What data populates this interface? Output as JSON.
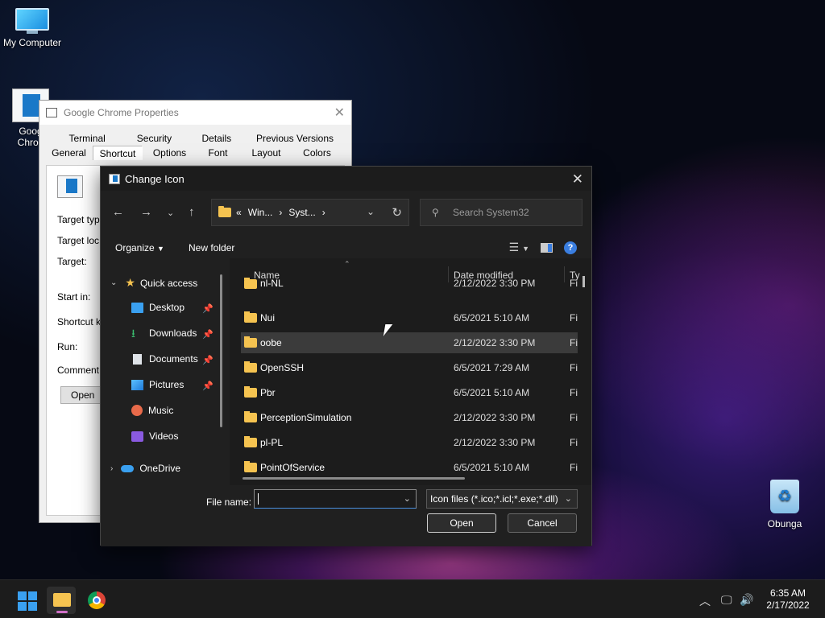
{
  "desktop": {
    "my_computer": "My Computer",
    "chrome_label_1": "Goog",
    "chrome_label_2": "Chron",
    "recycle": "Obunga"
  },
  "props": {
    "title": "Google Chrome Properties",
    "tabs_row1": [
      "Terminal",
      "Security",
      "Details",
      "Previous Versions"
    ],
    "tabs_row2": [
      "General",
      "Shortcut",
      "Options",
      "Font",
      "Layout",
      "Colors"
    ],
    "active_tab": "Shortcut",
    "labels": {
      "target_type": "Target typ",
      "target_location": "Target loc",
      "target": "Target:",
      "start_in": "Start in:",
      "shortcut_key": "Shortcut k",
      "run": "Run:",
      "comment": "Comment:"
    },
    "open_button": "Open"
  },
  "dialog": {
    "title": "Change Icon",
    "address": {
      "prefix": "«",
      "seg1": "Win...",
      "seg2": "Syst...",
      "sep": "›"
    },
    "search_placeholder": "Search System32",
    "organize": "Organize",
    "new_folder": "New folder",
    "nav": {
      "quick_access": "Quick access",
      "desktop": "Desktop",
      "downloads": "Downloads",
      "documents": "Documents",
      "pictures": "Pictures",
      "music": "Music",
      "videos": "Videos",
      "onedrive": "OneDrive"
    },
    "columns": {
      "name": "Name",
      "date": "Date modified",
      "type": "Ty"
    },
    "rows": [
      {
        "name": "nl-NL",
        "date": "2/12/2022 3:30 PM",
        "type": "Fi"
      },
      {
        "name": "Nui",
        "date": "6/5/2021 5:10 AM",
        "type": "Fi"
      },
      {
        "name": "oobe",
        "date": "2/12/2022 3:30 PM",
        "type": "Fi"
      },
      {
        "name": "OpenSSH",
        "date": "6/5/2021 7:29 AM",
        "type": "Fi"
      },
      {
        "name": "Pbr",
        "date": "6/5/2021 5:10 AM",
        "type": "Fi"
      },
      {
        "name": "PerceptionSimulation",
        "date": "2/12/2022 3:30 PM",
        "type": "Fi"
      },
      {
        "name": "pl-PL",
        "date": "2/12/2022 3:30 PM",
        "type": "Fi"
      },
      {
        "name": "PointOfService",
        "date": "6/5/2021 5:10 AM",
        "type": "Fi"
      }
    ],
    "file_name_label": "File name:",
    "file_name_value": "",
    "filter": "Icon files (*.ico;*.icl;*.exe;*.dll)",
    "open": "Open",
    "cancel": "Cancel"
  },
  "taskbar": {
    "time": "6:35 AM",
    "date": "2/17/2022"
  }
}
